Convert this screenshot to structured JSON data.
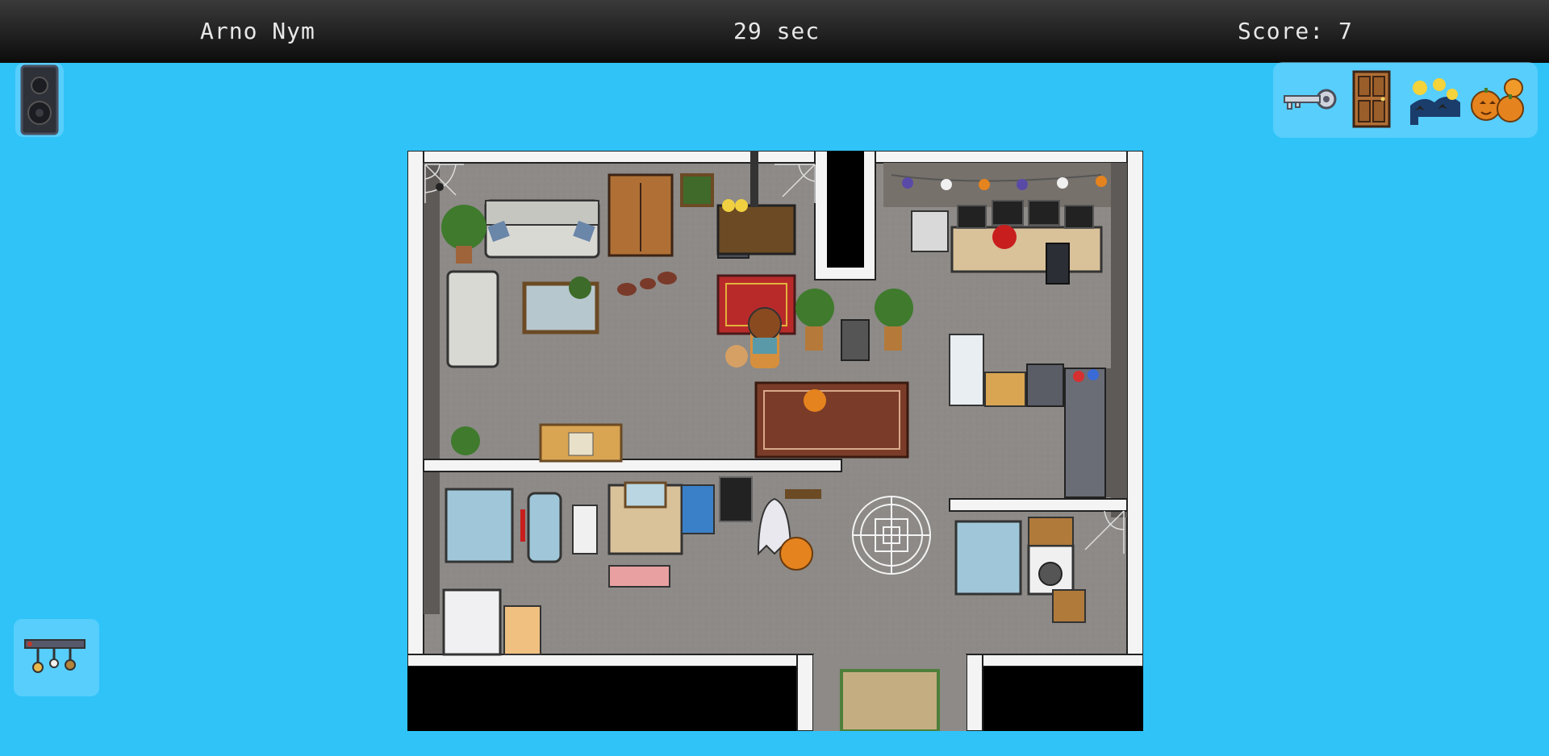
{
  "hud": {
    "player_name": "Arno Nym",
    "timer": "29 sec",
    "score": "Score: 7"
  },
  "colors": {
    "background": "#2fc3f8",
    "hud_bar": "#111111",
    "hud_text": "#e8e8e8",
    "floor": "#8d8a87",
    "wall": "#f4f4f4"
  },
  "left_tools": [
    {
      "icon": "speaker-icon"
    },
    {
      "icon": "key-rack-icon"
    }
  ],
  "inventory": [
    {
      "icon": "key-icon"
    },
    {
      "icon": "door-icon"
    },
    {
      "icon": "bats-on-tree-icon"
    },
    {
      "icon": "pumpkins-icon"
    }
  ],
  "scene": {
    "rooms": [
      "living-room",
      "office",
      "kitchen",
      "bathroom",
      "laundry",
      "entry-hall"
    ],
    "objects": [
      "player-character",
      "ghost",
      "pumpkin",
      "teddy-bear",
      "pentagram-sigil",
      "spider-web",
      "blood-stain",
      "halloween-garland",
      "red-rug",
      "brown-rug",
      "doormat"
    ]
  }
}
